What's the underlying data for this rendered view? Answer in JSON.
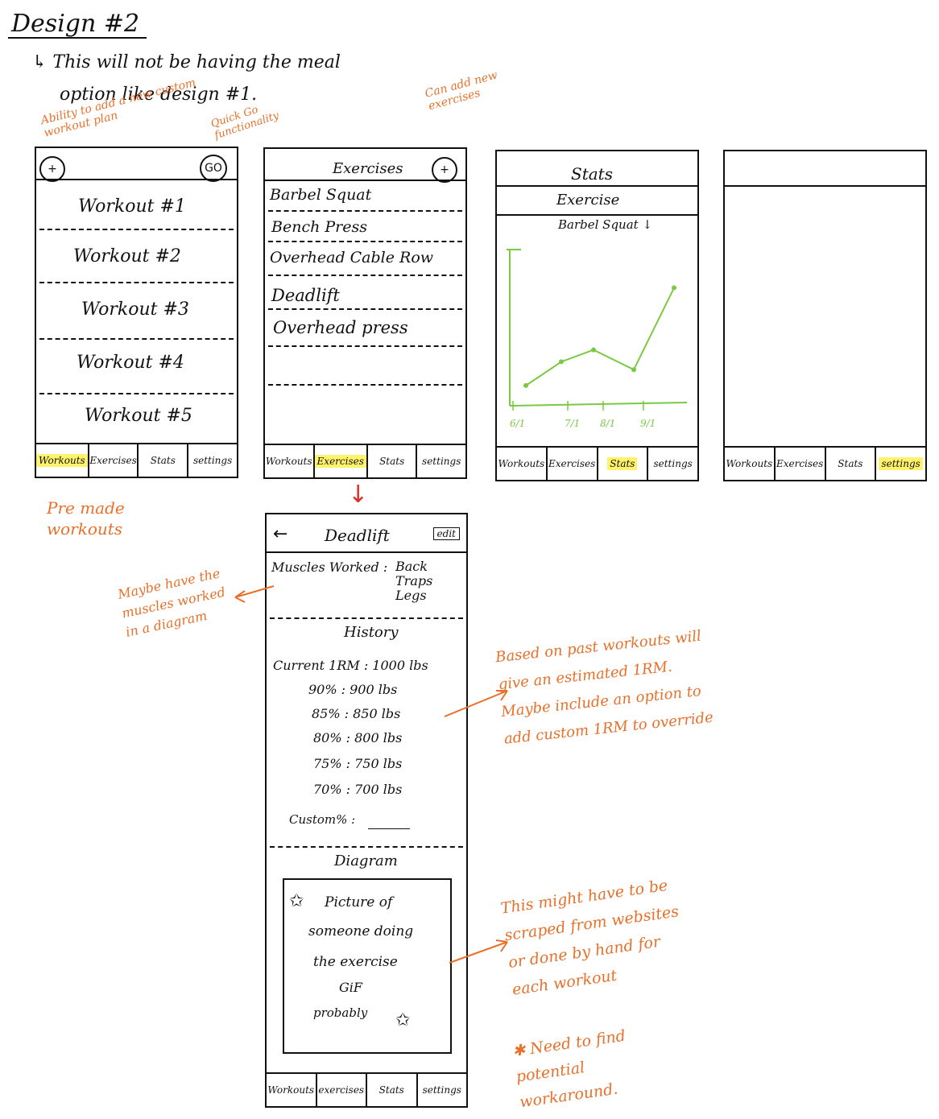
{
  "page": {
    "title": "Design #2",
    "subtitle_line1": "↳ This will not be having the meal",
    "subtitle_line2": "option like design #1."
  },
  "colors": {
    "annotation": "#e8702a",
    "highlight": "#fff36b",
    "chart_line": "#7ac943",
    "arrow": "#d9302b",
    "ink": "#111111"
  },
  "annotations": {
    "add_workout": "Ability to add a new custom workout plan",
    "quick_go": "Quick Go functionality",
    "add_exercise": "Can add new exercises",
    "premade": "Pre made workouts",
    "muscles_diagram": "Maybe have the muscles worked in a diagram",
    "estimated_1rm": "Based on past workouts will give an estimated 1RM. Maybe include an option to add custom 1RM to override",
    "scrape": "This might have to be scraped from websites or done by hand for each workout",
    "workaround": "Need to find potential workaround."
  },
  "nav": {
    "workouts": "Workouts",
    "exercises": "Exercises",
    "stats": "Stats",
    "settings": "settings",
    "workouts_lower": "Workouts",
    "exercises_lower": "exercises"
  },
  "screen1": {
    "add_icon": "plus-icon",
    "go_label": "GO",
    "workouts": [
      "Workout #1",
      "Workout #2",
      "Workout #3",
      "Workout #4",
      "Workout #5"
    ]
  },
  "screen2": {
    "title": "Exercises",
    "exercises": [
      "Barbel Squat",
      "Bench Press",
      "Overhead Cable Row",
      "Deadlift",
      "Overhead press"
    ]
  },
  "screen3": {
    "title": "Stats",
    "section": "Exercise",
    "selector": "Barbel Squat ↓"
  },
  "chart_data": {
    "type": "line",
    "title": "",
    "xlabel": "",
    "ylabel": "",
    "categories": [
      "6/1",
      "7/1",
      "8/1",
      "9/1"
    ],
    "series": [
      {
        "values": [
          0.08,
          0.26,
          0.35,
          0.2,
          0.82
        ]
      }
    ]
  },
  "screen5": {
    "back": "←",
    "title": "Deadlift",
    "edit": "edit",
    "muscles_label": "Muscles Worked :",
    "muscles": [
      "Back",
      "Traps",
      "Legs"
    ],
    "history_title": "History",
    "current_1rm": "Current 1RM : 1000 lbs",
    "percentages": [
      "90% : 900 lbs",
      "85% : 850 lbs",
      "80% : 800 lbs",
      "75% : 750 lbs",
      "70% : 700 lbs"
    ],
    "custom": "Custom% :",
    "diagram_title": "Diagram",
    "diagram_text": [
      "Picture of",
      "someone doing",
      "the exercise",
      "GiF",
      "probably"
    ]
  }
}
